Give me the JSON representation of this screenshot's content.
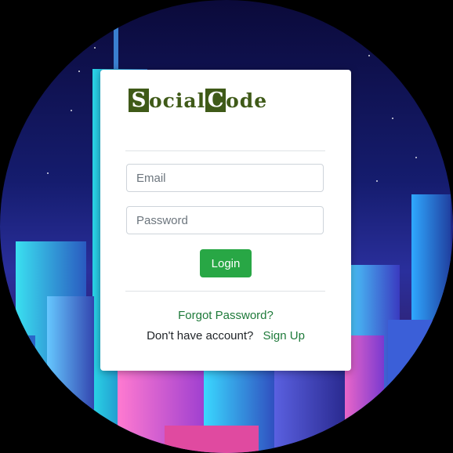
{
  "brand": {
    "initial_1": "S",
    "rest_1": "ocial",
    "initial_2": "C",
    "rest_2": "ode"
  },
  "form": {
    "email_placeholder": "Email",
    "password_placeholder": "Password",
    "login_label": "Login"
  },
  "links": {
    "forgot_password": "Forgot Password?",
    "no_account_text": "Don't have account?",
    "sign_up": "Sign Up"
  },
  "colors": {
    "brand": "#3f5a18",
    "button": "#28a745",
    "link": "#1e7a3a"
  }
}
